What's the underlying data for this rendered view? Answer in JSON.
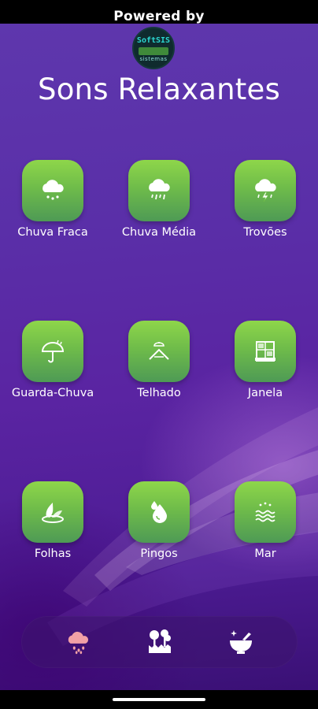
{
  "header": {
    "powered_label": "Powered by",
    "logo_text": "SoftSIS",
    "logo_subtext": "sistemas",
    "title": "Sons Relaxantes"
  },
  "sounds": [
    {
      "label": "Chuva Fraca",
      "icon": "light-rain-cloud-icon"
    },
    {
      "label": "Chuva Média",
      "icon": "medium-rain-cloud-icon"
    },
    {
      "label": "Trovões",
      "icon": "thunder-cloud-icon"
    },
    {
      "label": "Guarda-Chuva",
      "icon": "umbrella-icon"
    },
    {
      "label": "Telhado",
      "icon": "roof-icon"
    },
    {
      "label": "Janela",
      "icon": "window-icon"
    },
    {
      "label": "Folhas",
      "icon": "leaves-icon"
    },
    {
      "label": "Pingos",
      "icon": "drops-icon"
    },
    {
      "label": "Mar",
      "icon": "sea-icon"
    }
  ],
  "nav": {
    "items": [
      {
        "icon": "rain-cloud-icon",
        "active": true
      },
      {
        "icon": "nature-icon",
        "active": false
      },
      {
        "icon": "mortar-pestle-icon",
        "active": false
      }
    ]
  },
  "colors": {
    "tile_top": "#8ed64a",
    "tile_bottom": "#4e9a55",
    "background": "#5a24a2",
    "nav_active": "#f2a0a6"
  }
}
